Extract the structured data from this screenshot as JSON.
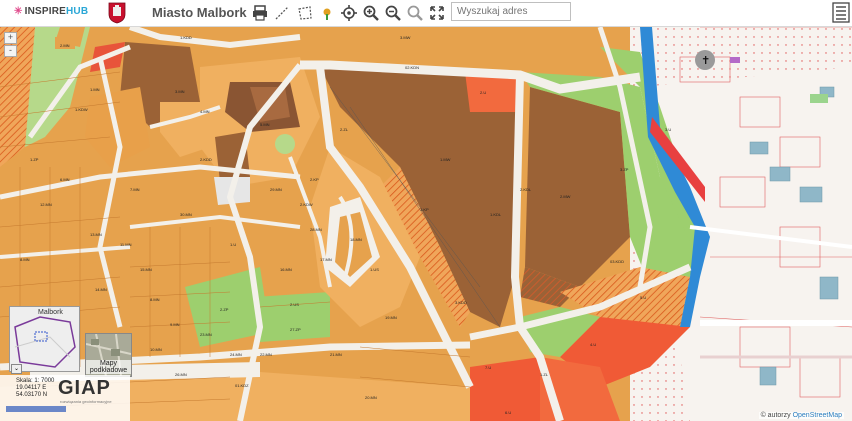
{
  "header": {
    "brand_prefix": "INSPIRE",
    "brand_suffix": "HUB",
    "city_title": "Miasto Malbork",
    "search_placeholder": "Wyszukaj adres",
    "tools": [
      "print-icon",
      "measure-line-icon",
      "measure-area-icon",
      "pin-icon",
      "locate-icon",
      "zoom-in-icon",
      "zoom-out-icon",
      "zoom-extent-icon",
      "fullscreen-icon"
    ]
  },
  "map": {
    "zoom_in": "+",
    "zoom_out": "-",
    "minimap_label": "Malbork",
    "basemap_label": "Mapy podkładowe",
    "scale": "Skala: 1: 7000",
    "lon": "19.04117 E",
    "lat": "54.03170 N",
    "provider": "GIAP",
    "provider_sub": "rozwiązania geoinformacyjne",
    "attribution_prefix": "© autorzy",
    "attribution_link": "OpenStreetMap",
    "parcel_labels": [
      "2.MN",
      "1.MN",
      "3.MN",
      "4.MN",
      "5.MN",
      "6.MN",
      "7.MN",
      "8.MN",
      "1.U",
      "2.U",
      "3.U",
      "1.ZP",
      "2.ZP",
      "3.ZP",
      "1.KDD",
      "2.KDD",
      "3.KDD",
      "1.KDL",
      "2.KDL",
      "01.KDZ",
      "02.KDN",
      "03.KDD",
      "1.KDW",
      "2.KDW",
      "1.MW",
      "2.MW",
      "3.MW",
      "1.US",
      "2.US",
      "4.U",
      "5.U",
      "6.U",
      "7.U",
      "1.ZL",
      "2.ZL",
      "1.KP",
      "2.KP",
      "8.MN",
      "9.MN",
      "10.MN",
      "11.MN",
      "12.MN",
      "13.MN",
      "14.MN",
      "15.MN",
      "16.MN",
      "17.MN",
      "18.MN",
      "19.MN",
      "20.MN",
      "21.MN",
      "22.MN",
      "23.MN",
      "24.MN",
      "25.MN",
      "26.MN",
      "27.ZP",
      "28.MN",
      "29.MN",
      "30.MN"
    ]
  }
}
